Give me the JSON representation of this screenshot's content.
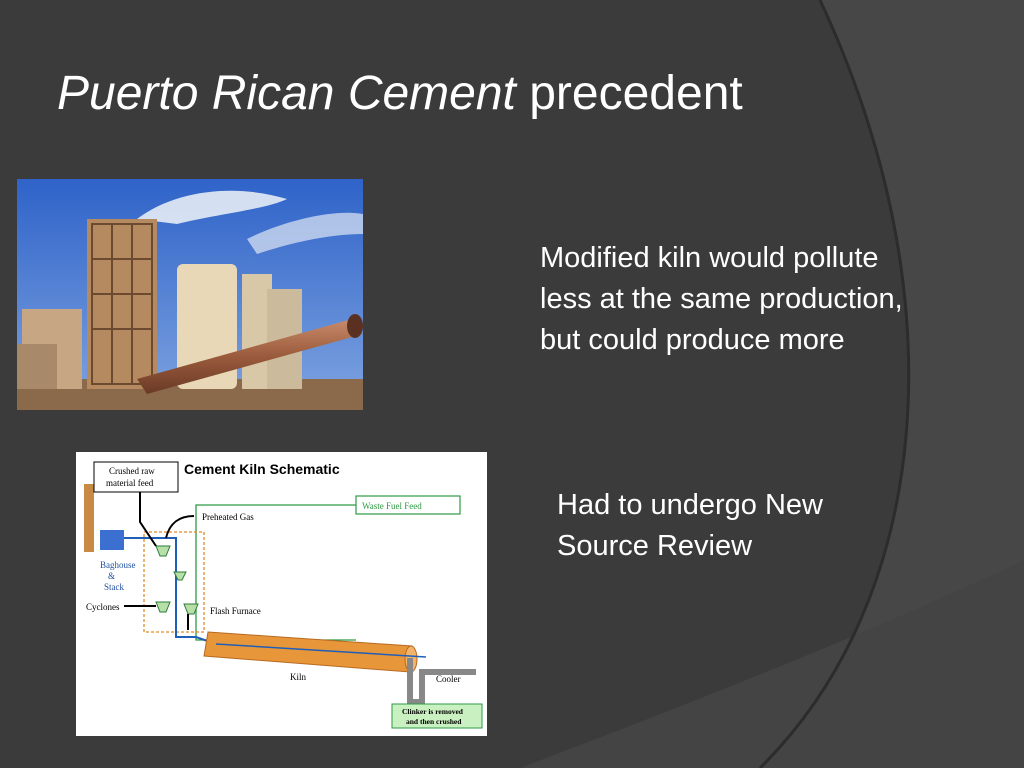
{
  "slide": {
    "title_italic": "Puerto Rican Cement",
    "title_rest": "precedent",
    "text_blocks": [
      "Modified kiln would pollute less at the same production, but could produce more",
      "Had to undergo New Source Review"
    ]
  },
  "schematic": {
    "title": "Cement Kiln Schematic",
    "labels": {
      "raw_feed_1": "Crushed raw",
      "raw_feed_2": "material feed",
      "waste_fuel": "Waste Fuel Feed",
      "preheated_gas": "Preheated Gas",
      "baghouse_1": "Baghouse",
      "baghouse_2": "&",
      "baghouse_3": "Stack",
      "cyclones": "Cyclones",
      "flash_furnace": "Flash Furnace",
      "kiln": "Kiln",
      "cooler": "Cooler",
      "clinker_1": "Clinker is removed",
      "clinker_2": "and then crushed"
    }
  },
  "colors": {
    "background": "#3a3a3a",
    "text": "#ffffff",
    "kiln": "#e8963a",
    "pipe_blue": "#1f5fb8",
    "green_line": "#2e9a44"
  }
}
